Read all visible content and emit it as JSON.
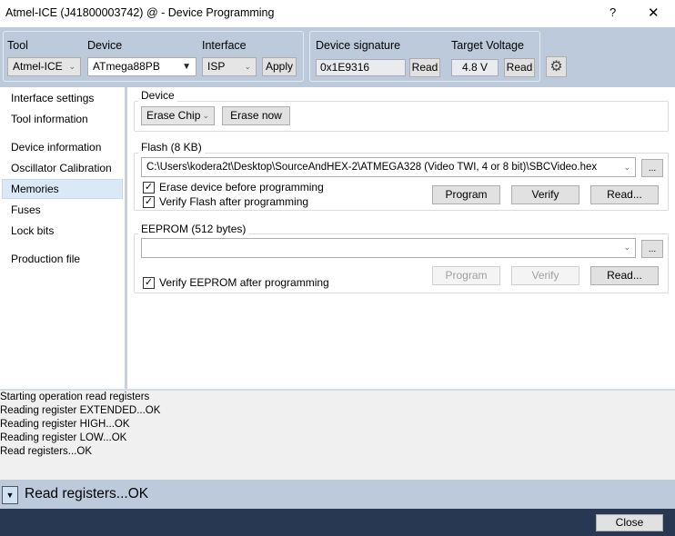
{
  "window": {
    "title": "Atmel-ICE (J41800003742) @  - Device Programming",
    "help": "?",
    "close": "✕"
  },
  "toolbar": {
    "tool_label": "Tool",
    "tool_value": "Atmel-ICE",
    "device_label": "Device",
    "device_value": "ATmega88PB",
    "interface_label": "Interface",
    "interface_value": "ISP",
    "apply": "Apply",
    "signature_label": "Device signature",
    "signature_value": "0x1E9316",
    "signature_read": "Read",
    "voltage_label": "Target Voltage",
    "voltage_value": "4.8 V",
    "voltage_read": "Read",
    "settings_icon": "gear-icon"
  },
  "sidebar": {
    "items": [
      {
        "label": "Interface settings"
      },
      {
        "label": "Tool information"
      },
      {
        "label": "Device information"
      },
      {
        "label": "Oscillator Calibration"
      },
      {
        "label": "Memories",
        "selected": true
      },
      {
        "label": "Fuses"
      },
      {
        "label": "Lock bits"
      },
      {
        "label": "Production file"
      }
    ]
  },
  "device": {
    "legend": "Device",
    "erase_mode": "Erase Chip",
    "erase_now": "Erase now"
  },
  "flash": {
    "legend": "Flash (8 KB)",
    "path": "C:\\Users\\kodera2t\\Desktop\\SourceAndHEX-2\\ATMEGA328 (Video TWI, 4 or 8 bit)\\SBCVideo.hex",
    "browse": "...",
    "erase_before": "Erase device before programming",
    "verify_after": "Verify Flash after programming",
    "program": "Program",
    "verify": "Verify",
    "read": "Read..."
  },
  "eeprom": {
    "legend": "EEPROM (512 bytes)",
    "path": "",
    "browse": "...",
    "verify_after": "Verify EEPROM after programming",
    "program": "Program",
    "verify": "Verify",
    "read": "Read..."
  },
  "log": [
    "Starting operation read registers",
    "Reading register EXTENDED...OK",
    "Reading register HIGH...OK",
    "Reading register LOW...OK",
    "Read registers...OK"
  ],
  "status": {
    "text": "Read registers...OK"
  },
  "footer": {
    "close": "Close"
  }
}
